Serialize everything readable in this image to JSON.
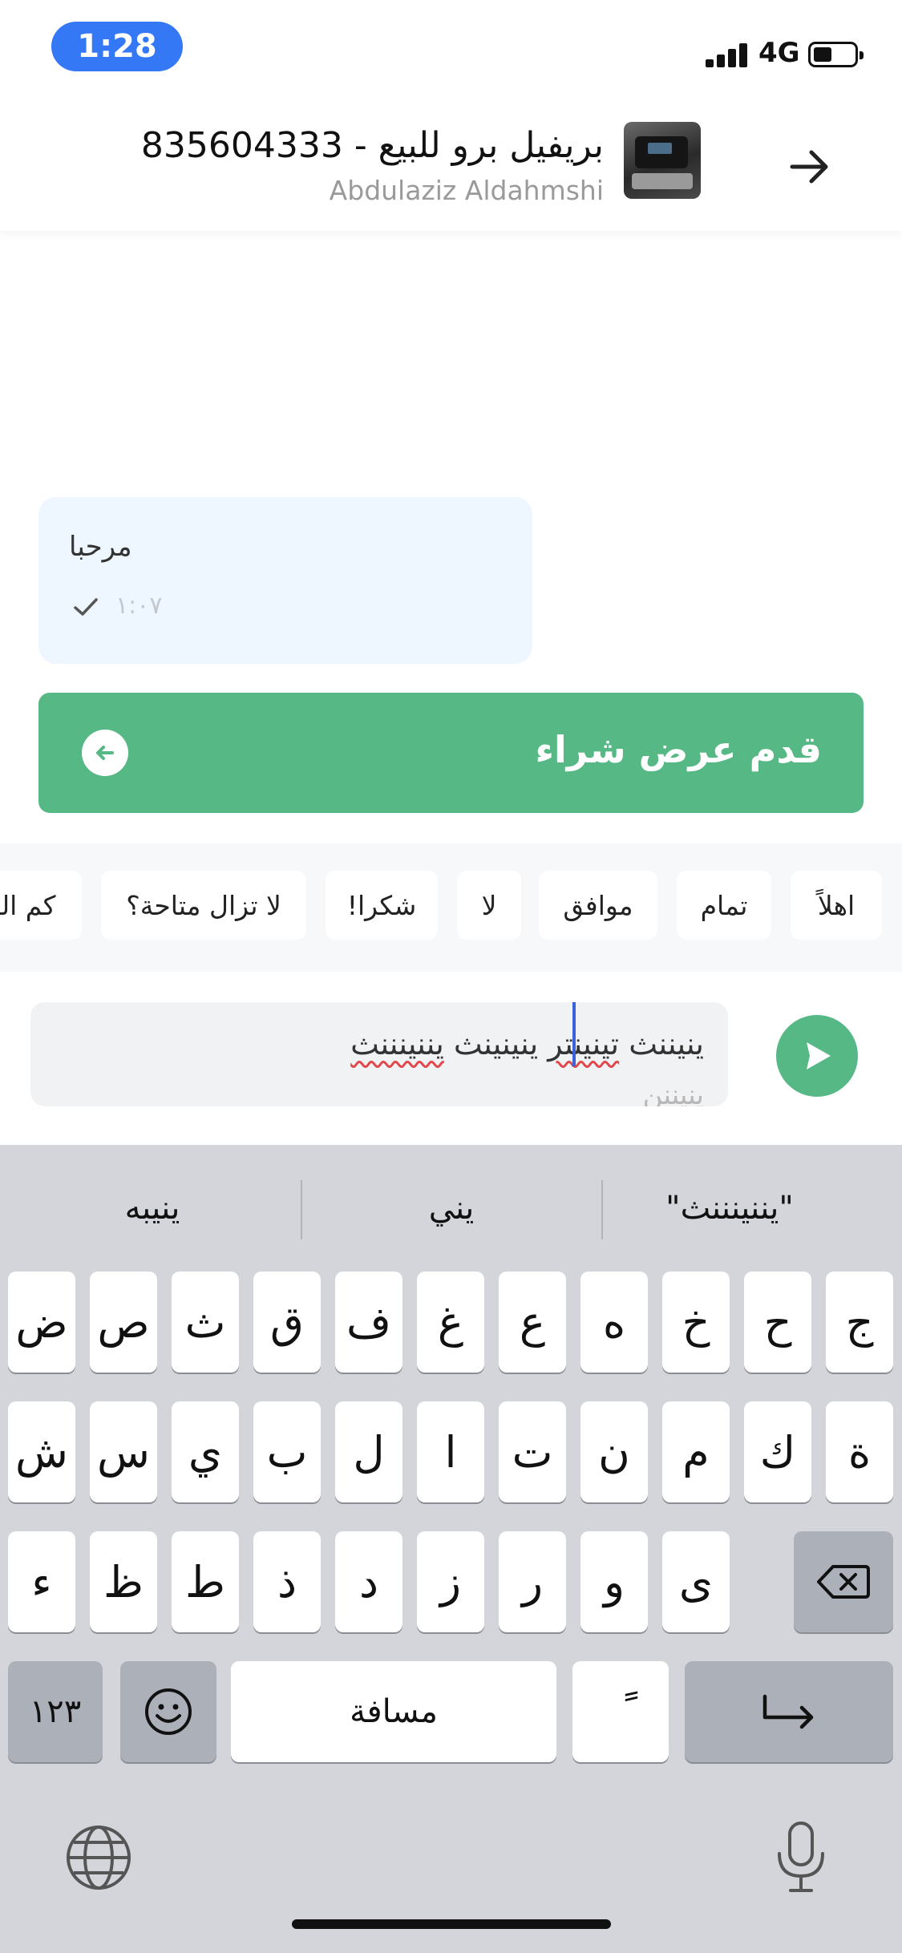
{
  "status_bar": {
    "time": "1:28",
    "network": "4G"
  },
  "header": {
    "title": "بريفيل برو للبيع - 835604333",
    "seller": "Abdulaziz Aldahmshi"
  },
  "message": {
    "text": "مرحبا",
    "time": "١:٠٧"
  },
  "offer": {
    "label": "قدم عرض شراء"
  },
  "quick_replies": [
    "اهلاً",
    "تمام",
    "موافق",
    "لا",
    "شكرا!",
    "لا تزال متاحة؟",
    "كم الس"
  ],
  "composer": {
    "misspelled_a": "يننينننث",
    "word_b": "ينيننث",
    "misspelled_c": "ينينينث",
    "word_d": "تينينتر",
    "after_caret": "تينينتر"
  },
  "keyboard": {
    "suggestions": [
      "\"يننينننث\"",
      "يني",
      "ينيبه"
    ],
    "row1": [
      "ج",
      "ح",
      "خ",
      "ه",
      "ع",
      "غ",
      "ف",
      "ق",
      "ث",
      "ص",
      "ض"
    ],
    "row2": [
      "ة",
      "ك",
      "م",
      "ن",
      "ت",
      "ا",
      "ل",
      "ب",
      "ي",
      "س",
      "ش"
    ],
    "row3": [
      "ى",
      "و",
      "ر",
      "ز",
      "د",
      "ذ",
      "ط",
      "ظ",
      "ء"
    ],
    "numbers_label": "١٢٣",
    "space_label": "مسافة",
    "diacritic_label": "ً"
  }
}
